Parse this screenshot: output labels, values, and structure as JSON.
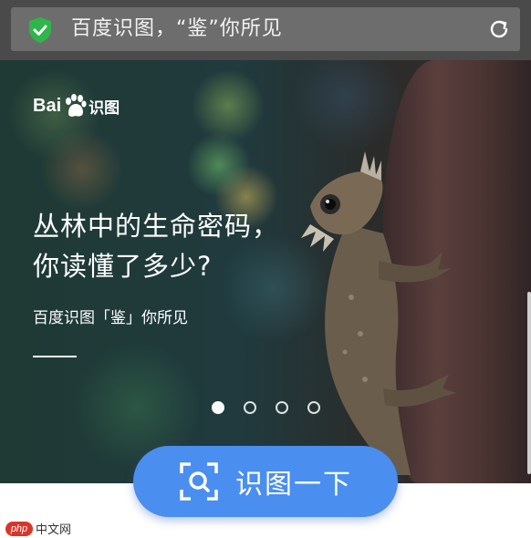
{
  "address_bar": {
    "title": "百度识图，“鉴”你所见",
    "secure_icon": "shield-check-icon",
    "refresh_icon": "refresh-icon"
  },
  "hero": {
    "logo_prefix": "Bai",
    "logo_suffix": "识图",
    "headline_line1": "丛林中的生命密码，",
    "headline_line2": "你读懂了多少?",
    "subline": "百度识图「鉴」你所见",
    "carousel": {
      "count": 4,
      "active_index": 1
    }
  },
  "cta": {
    "label": "识图一下",
    "icon": "scan-camera-icon"
  },
  "watermark": {
    "badge": "php",
    "text": "中文网"
  },
  "colors": {
    "topbar": "#4a4a4a",
    "urlbox": "#6d6d6d",
    "shield_green": "#2fb54a",
    "cta_blue": "#4a8ef0",
    "watermark_red": "#d9362b"
  }
}
